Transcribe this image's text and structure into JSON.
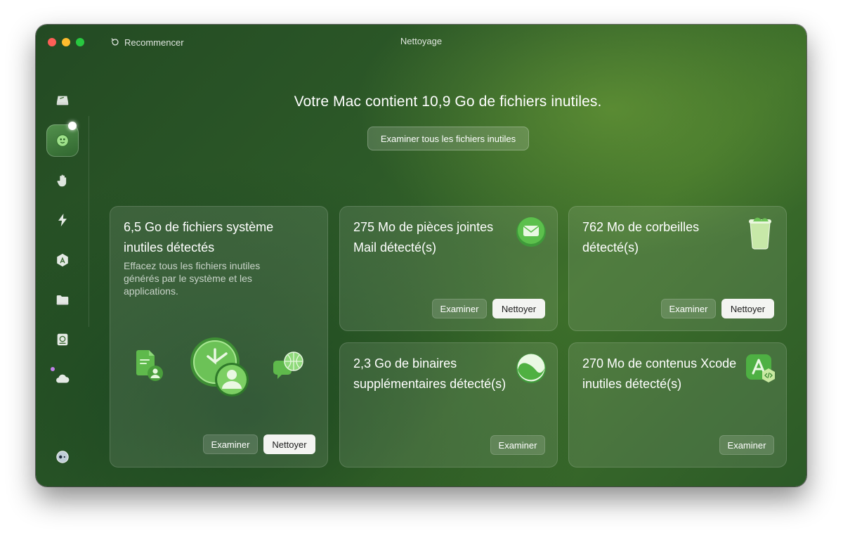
{
  "window": {
    "title": "Nettoyage",
    "restart_label": "Recommencer"
  },
  "sidebar": {
    "items": [
      {
        "icon": "disk-icon"
      },
      {
        "icon": "cleanup-icon",
        "active": true
      },
      {
        "icon": "hand-icon"
      },
      {
        "icon": "speed-icon"
      },
      {
        "icon": "app-store-icon"
      },
      {
        "icon": "folder-icon"
      },
      {
        "icon": "disk-drive-icon"
      },
      {
        "icon": "cloud-icon"
      }
    ],
    "bottom_icon": "assistant-icon"
  },
  "main": {
    "headline": "Votre Mac contient 10,9 Go de fichiers inutiles.",
    "review_all_label": "Examiner tous les fichiers inutiles"
  },
  "cards": {
    "system": {
      "title": "6,5 Go de fichiers système inutiles détectés",
      "description": "Effacez tous les fichiers inutiles générés par le système et les applications.",
      "review_label": "Examiner",
      "clean_label": "Nettoyer"
    },
    "mail": {
      "title": "275 Mo de pièces jointes Mail détecté(s)",
      "review_label": "Examiner",
      "clean_label": "Nettoyer"
    },
    "trash": {
      "title": "762 Mo de corbeilles détecté(s)",
      "review_label": "Examiner",
      "clean_label": "Nettoyer"
    },
    "binaries": {
      "title": "2,3 Go de binaires supplémentaires détecté(s)",
      "review_label": "Examiner"
    },
    "xcode": {
      "title": "270 Mo de contenus Xcode inutiles détecté(s)",
      "review_label": "Examiner"
    }
  },
  "colors": {
    "accent": "#5aa84a",
    "window_bg": "#2d5a28",
    "primary_button": "#f3f4f1"
  }
}
